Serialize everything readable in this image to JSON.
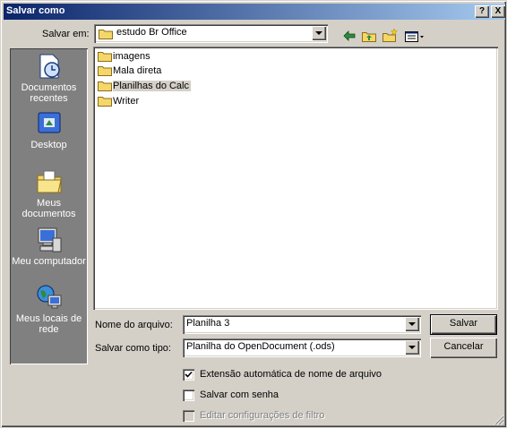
{
  "window": {
    "title": "Salvar como"
  },
  "titlebar": {
    "help_glyph": "?",
    "close_glyph": "X"
  },
  "save_in": {
    "label": "Salvar em:",
    "value": "estudo Br Office"
  },
  "places": [
    {
      "label": "Documentos recentes",
      "icon": "recent-documents-icon"
    },
    {
      "label": "Desktop",
      "icon": "desktop-icon"
    },
    {
      "label": "Meus documentos",
      "icon": "my-documents-icon"
    },
    {
      "label": "Meu computador",
      "icon": "my-computer-icon"
    },
    {
      "label": "Meus locais de rede",
      "icon": "network-places-icon"
    }
  ],
  "files": [
    {
      "name": "imagens",
      "selected": false
    },
    {
      "name": "Mala direta",
      "selected": false
    },
    {
      "name": "Planilhas do Calc",
      "selected": true
    },
    {
      "name": "Writer",
      "selected": false
    }
  ],
  "filename": {
    "label": "Nome do arquivo:",
    "value": "Planilha 3"
  },
  "filetype": {
    "label": "Salvar como tipo:",
    "value": "Planilha do OpenDocument (.ods)"
  },
  "buttons": {
    "save": "Salvar",
    "cancel": "Cancelar"
  },
  "options": {
    "auto_extension": {
      "label": "Extensão automática de nome de arquivo",
      "checked": true,
      "enabled": true
    },
    "password": {
      "label": "Salvar com senha",
      "checked": false,
      "enabled": true
    },
    "filter": {
      "label": "Editar configurações de filtro",
      "checked": false,
      "enabled": false
    }
  },
  "colors": {
    "title_start": "#0a246a",
    "title_end": "#a6caf0",
    "face": "#d4d0c8",
    "places_bg": "#808080",
    "folder": "#f4d768"
  }
}
